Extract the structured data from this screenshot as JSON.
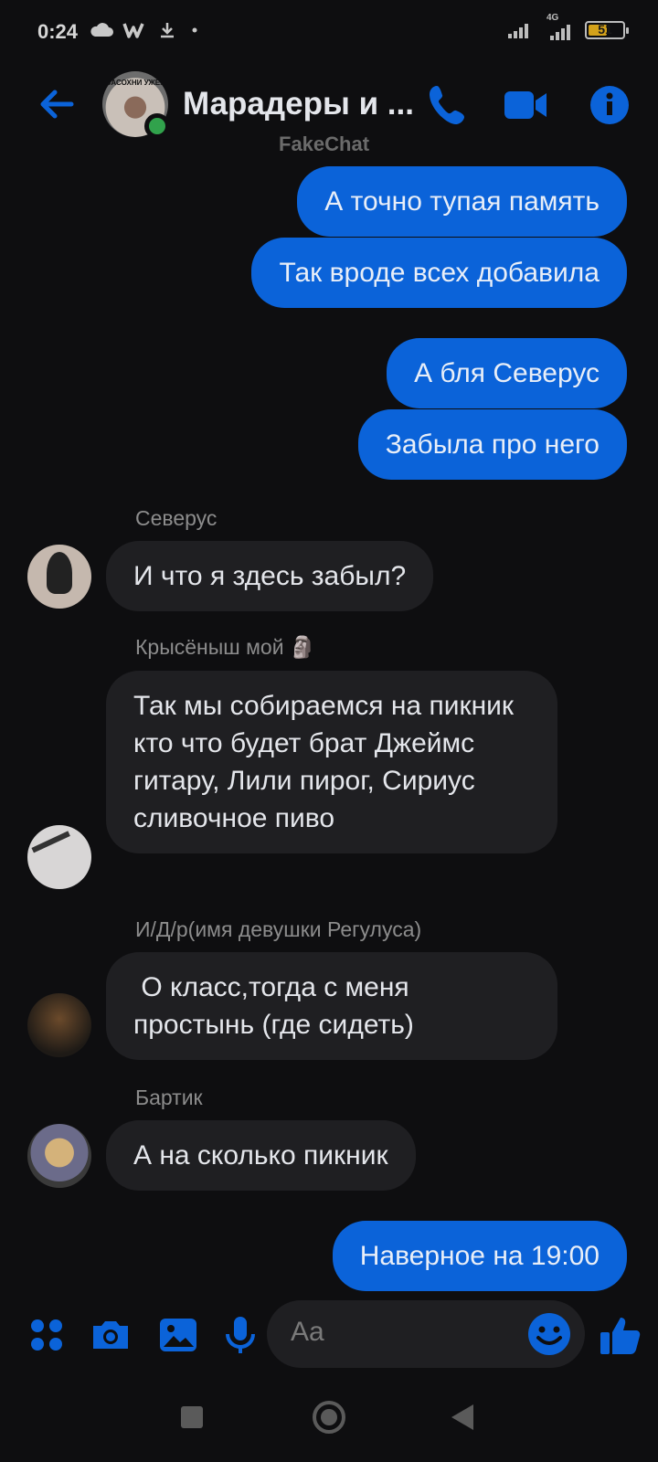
{
  "status_bar": {
    "time": "0:24",
    "left_icons": [
      "cloud-icon",
      "w-app-icon",
      "download-icon",
      "dot-icon"
    ],
    "network_label": "4G",
    "battery_level": "51"
  },
  "header": {
    "title": "Марадеры и ...",
    "subtitle": "FakeChat",
    "avatar_caption": "ЗАСОХНИ УЖЕ..",
    "accent_color": "#0b63d9"
  },
  "messages": [
    {
      "type": "outgoing",
      "text": "А точно тупая память"
    },
    {
      "type": "outgoing",
      "text": "Так вроде всех добавила"
    },
    {
      "type": "outgoing",
      "text": "А бля Северус"
    },
    {
      "type": "outgoing",
      "text": "Забыла про него"
    },
    {
      "type": "incoming",
      "sender": "Северус",
      "text": "И что я здесь забыл?"
    },
    {
      "type": "incoming",
      "sender": "Крысёныш мой 🗿",
      "text": "Так мы собираемся на пикник кто что будет брат Джеймс гитару, Лили пирог, Сириус сливочное пиво"
    },
    {
      "type": "incoming",
      "sender": "И/Д/р(имя девушки Регулуса)",
      "text": " О класс,тогда с меня простынь (где сидеть)"
    },
    {
      "type": "incoming",
      "sender": "Бартик",
      "text": "А на сколько пикник"
    },
    {
      "type": "outgoing",
      "text": "Наверное на 19:00"
    }
  ],
  "composer": {
    "placeholder": "Aa",
    "icons": [
      "apps-icon",
      "camera-icon",
      "gallery-icon",
      "microphone-icon",
      "emoji-icon",
      "thumbs-up-icon"
    ]
  }
}
